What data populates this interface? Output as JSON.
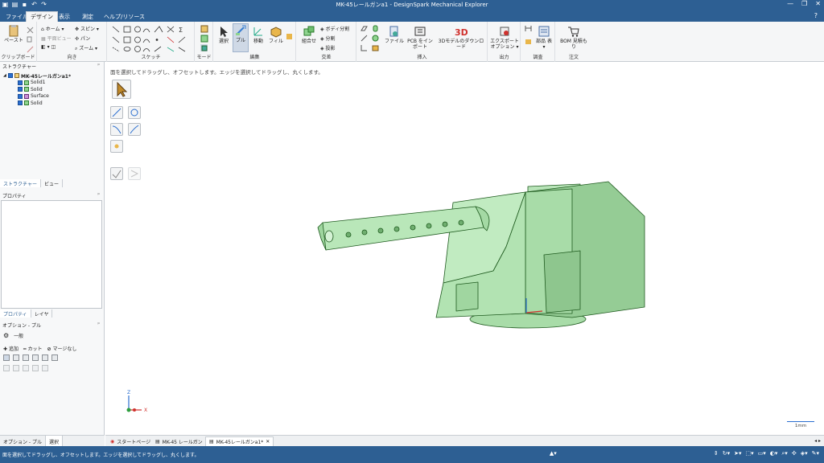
{
  "window": {
    "title": "MK-45レールガンa1 - DesignSpark Mechanical Explorer",
    "minimize": "—",
    "restore": "❐",
    "close": "✕"
  },
  "menu": {
    "tabs": [
      "ファイル",
      "デザイン",
      "表示",
      "測定",
      "ヘルプ/リソース"
    ],
    "active_tab": "デザイン"
  },
  "ribbon": {
    "clipboard": {
      "paste": "ペースト",
      "group": "クリップボード"
    },
    "orient": {
      "home": "ホーム",
      "plane_view": "平面ビュー",
      "spin": "スピン",
      "pan": "パン",
      "zoom": "ズーム",
      "group": "向き"
    },
    "sketch": {
      "group": "スケッチ"
    },
    "mode": {
      "group": "モード"
    },
    "edit": {
      "select": "選択",
      "pull": "プル",
      "move": "移動",
      "fill": "フィル",
      "group": "編集"
    },
    "intersect": {
      "combine": "組合せ",
      "split_body": "ボディ分割",
      "split": "分割",
      "project": "投影",
      "group": "交差"
    },
    "insert": {
      "file": "ファイル",
      "pcb": "PCB をイン ポート",
      "model_download": "3Dモデルのダウンロード",
      "group": "挿入"
    },
    "output": {
      "export": "エクスポート オプション",
      "group": "出力"
    },
    "investigate": {
      "parts": "部品 表",
      "group": "調査"
    },
    "order": {
      "bom": "BOM 見積も り",
      "group": "注文"
    }
  },
  "structure": {
    "header": "ストラクチャー",
    "root": "MK-45レールガンa1*",
    "items": [
      "Solid1",
      "Solid",
      "Surface",
      "Solid"
    ],
    "tabs": [
      "ストラクチャー",
      "ビュー"
    ]
  },
  "properties": {
    "header": "プロパティ",
    "tabs": [
      "プロパティ",
      "レイヤ"
    ]
  },
  "options": {
    "header": "オプション - プル",
    "general": "一般",
    "add": "追加",
    "cut": "カット",
    "no_merge": "マージなし",
    "bottom_tabs": [
      "オプション - プル",
      "選択"
    ]
  },
  "viewport": {
    "hint": "面を選択してドラッグし、オフセットします。エッジを選択してドラッグし、丸くします。",
    "scale": "1mm",
    "axis_z": "Z",
    "axis_x": "X"
  },
  "doc_tabs": {
    "tabs": [
      "スタートページ",
      "MK-45 レールガン",
      "MK-45レールガンa1*"
    ],
    "active": "MK-45レールガンa1*",
    "close": "✕"
  },
  "status": {
    "text": "面を選択してドラッグし、オフセットします。エッジを選択してドラッグし、丸くします。"
  },
  "colors": {
    "chrome_blue": "#2d5f93",
    "model_green": "#a8dca8",
    "model_edge": "#1e5a1e"
  }
}
